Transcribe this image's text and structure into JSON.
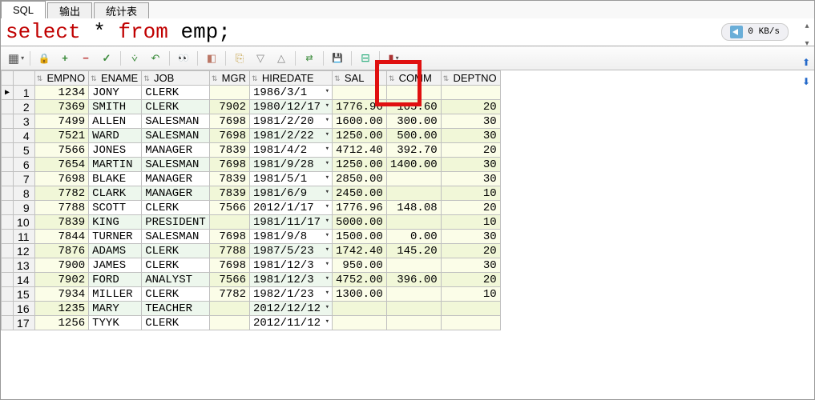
{
  "tabs": [
    {
      "label": "SQL",
      "active": true
    },
    {
      "label": "输出",
      "active": false
    },
    {
      "label": "统计表",
      "active": false
    }
  ],
  "sql": {
    "keyword1": "select",
    "star": " * ",
    "keyword2": "from",
    "rest": " emp;"
  },
  "net_badge": "0 KB/s",
  "columns": [
    "EMPNO",
    "ENAME",
    "JOB",
    "MGR",
    "HIREDATE",
    "SAL",
    "COMM",
    "DEPTNO"
  ],
  "col_types": [
    "num",
    "txt",
    "txt",
    "num",
    "dt",
    "num",
    "num",
    "num"
  ],
  "rows": [
    {
      "n": 1,
      "ptr": "▶",
      "EMPNO": "1234",
      "ENAME": "JONY",
      "JOB": "CLERK",
      "MGR": "",
      "HIREDATE": "1986/3/1",
      "SAL": "",
      "COMM": "",
      "DEPTNO": ""
    },
    {
      "n": 2,
      "EMPNO": "7369",
      "ENAME": "SMITH",
      "JOB": "CLERK",
      "MGR": "7902",
      "HIREDATE": "1980/12/17",
      "SAL": "1776.96",
      "COMM": "105.60",
      "DEPTNO": "20"
    },
    {
      "n": 3,
      "EMPNO": "7499",
      "ENAME": "ALLEN",
      "JOB": "SALESMAN",
      "MGR": "7698",
      "HIREDATE": "1981/2/20",
      "SAL": "1600.00",
      "COMM": "300.00",
      "DEPTNO": "30"
    },
    {
      "n": 4,
      "EMPNO": "7521",
      "ENAME": "WARD",
      "JOB": "SALESMAN",
      "MGR": "7698",
      "HIREDATE": "1981/2/22",
      "SAL": "1250.00",
      "COMM": "500.00",
      "DEPTNO": "30"
    },
    {
      "n": 5,
      "EMPNO": "7566",
      "ENAME": "JONES",
      "JOB": "MANAGER",
      "MGR": "7839",
      "HIREDATE": "1981/4/2",
      "SAL": "4712.40",
      "COMM": "392.70",
      "DEPTNO": "20"
    },
    {
      "n": 6,
      "EMPNO": "7654",
      "ENAME": "MARTIN",
      "JOB": "SALESMAN",
      "MGR": "7698",
      "HIREDATE": "1981/9/28",
      "SAL": "1250.00",
      "COMM": "1400.00",
      "DEPTNO": "30"
    },
    {
      "n": 7,
      "EMPNO": "7698",
      "ENAME": "BLAKE",
      "JOB": "MANAGER",
      "MGR": "7839",
      "HIREDATE": "1981/5/1",
      "SAL": "2850.00",
      "COMM": "",
      "DEPTNO": "30"
    },
    {
      "n": 8,
      "EMPNO": "7782",
      "ENAME": "CLARK",
      "JOB": "MANAGER",
      "MGR": "7839",
      "HIREDATE": "1981/6/9",
      "SAL": "2450.00",
      "COMM": "",
      "DEPTNO": "10"
    },
    {
      "n": 9,
      "EMPNO": "7788",
      "ENAME": "SCOTT",
      "JOB": "CLERK",
      "MGR": "7566",
      "HIREDATE": "2012/1/17",
      "SAL": "1776.96",
      "COMM": "148.08",
      "DEPTNO": "20"
    },
    {
      "n": 10,
      "EMPNO": "7839",
      "ENAME": "KING",
      "JOB": "PRESIDENT",
      "MGR": "",
      "HIREDATE": "1981/11/17",
      "SAL": "5000.00",
      "COMM": "",
      "DEPTNO": "10"
    },
    {
      "n": 11,
      "EMPNO": "7844",
      "ENAME": "TURNER",
      "JOB": "SALESMAN",
      "MGR": "7698",
      "HIREDATE": "1981/9/8",
      "SAL": "1500.00",
      "COMM": "0.00",
      "DEPTNO": "30"
    },
    {
      "n": 12,
      "EMPNO": "7876",
      "ENAME": "ADAMS",
      "JOB": "CLERK",
      "MGR": "7788",
      "HIREDATE": "1987/5/23",
      "SAL": "1742.40",
      "COMM": "145.20",
      "DEPTNO": "20"
    },
    {
      "n": 13,
      "EMPNO": "7900",
      "ENAME": "JAMES",
      "JOB": "CLERK",
      "MGR": "7698",
      "HIREDATE": "1981/12/3",
      "SAL": "950.00",
      "COMM": "",
      "DEPTNO": "30"
    },
    {
      "n": 14,
      "EMPNO": "7902",
      "ENAME": "FORD",
      "JOB": "ANALYST",
      "MGR": "7566",
      "HIREDATE": "1981/12/3",
      "SAL": "4752.00",
      "COMM": "396.00",
      "DEPTNO": "20"
    },
    {
      "n": 15,
      "EMPNO": "7934",
      "ENAME": "MILLER",
      "JOB": "CLERK",
      "MGR": "7782",
      "HIREDATE": "1982/1/23",
      "SAL": "1300.00",
      "COMM": "",
      "DEPTNO": "10"
    },
    {
      "n": 16,
      "EMPNO": "1235",
      "ENAME": "MARY",
      "JOB": "TEACHER",
      "MGR": "",
      "HIREDATE": "2012/12/12",
      "SAL": "",
      "COMM": "",
      "DEPTNO": ""
    },
    {
      "n": 17,
      "EMPNO": "1256",
      "ENAME": "TYYK",
      "JOB": "CLERK",
      "MGR": "",
      "HIREDATE": "2012/11/12",
      "SAL": "",
      "COMM": "",
      "DEPTNO": ""
    }
  ]
}
